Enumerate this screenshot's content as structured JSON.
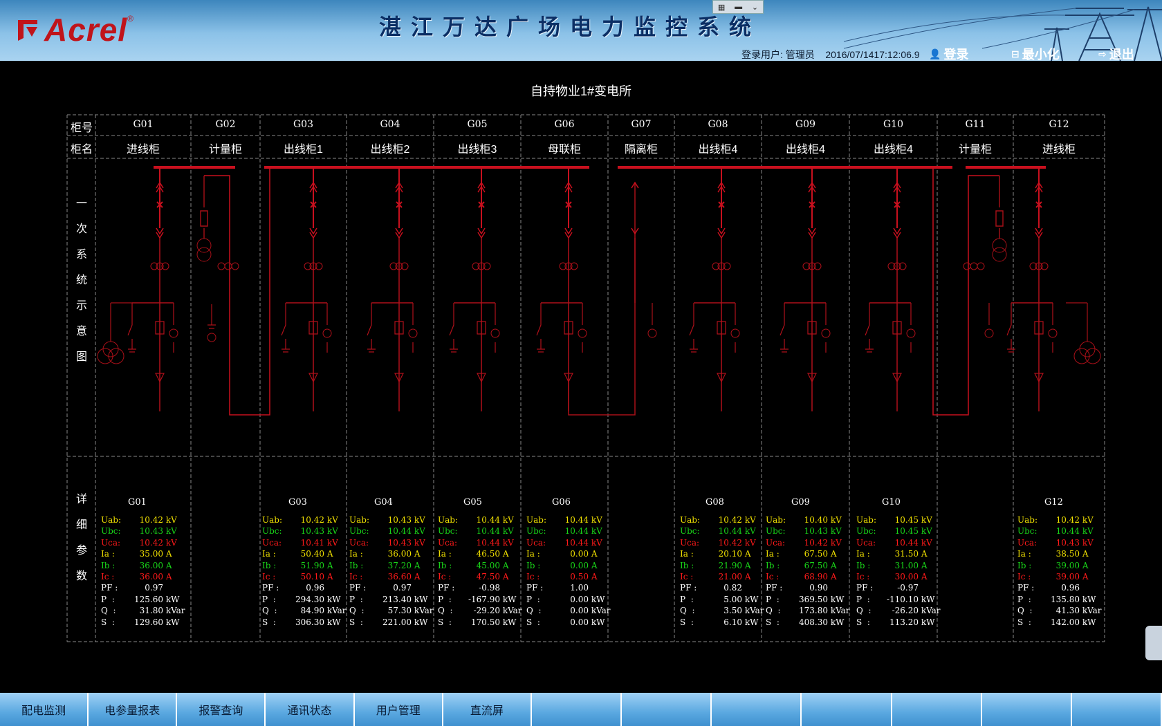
{
  "header": {
    "logo_text": "Acrel",
    "logo_mark": "®",
    "title": "湛江万达广场电力监控系统",
    "login_user_label": "登录用户: 管理员",
    "datetime": "2016/07/1417:12:06.9",
    "login_button": "登录",
    "minimize_button": "最小化",
    "exit_button": "退出"
  },
  "panel_title": "自持物业1#变电所",
  "grid": {
    "row_label_cabinet_no": "柜号",
    "row_label_cabinet_name": "柜名",
    "diagram_label": [
      "一",
      "次",
      "系",
      "统",
      "示",
      "意",
      "图"
    ],
    "params_label": [
      "详",
      "细",
      "参",
      "数"
    ]
  },
  "cabinets": [
    {
      "no": "G01",
      "name": "进线柜"
    },
    {
      "no": "G02",
      "name": "计量柜"
    },
    {
      "no": "G03",
      "name": "出线柜1"
    },
    {
      "no": "G04",
      "name": "出线柜2"
    },
    {
      "no": "G05",
      "name": "出线柜3"
    },
    {
      "no": "G06",
      "name": "母联柜"
    },
    {
      "no": "G07",
      "name": "隔离柜"
    },
    {
      "no": "G08",
      "name": "出线柜4"
    },
    {
      "no": "G09",
      "name": "出线柜4"
    },
    {
      "no": "G10",
      "name": "出线柜4"
    },
    {
      "no": "G11",
      "name": "计量柜"
    },
    {
      "no": "G12",
      "name": "进线柜"
    }
  ],
  "params": [
    {
      "id": "G01",
      "Uab": "10.42",
      "Ubc": "10.43",
      "Uca": "10.42",
      "Ia": "35.00",
      "Ib": "36.00",
      "Ic": "36.00",
      "PF": "0.97",
      "P": "125.60",
      "Q": "31.80",
      "S": "129.60"
    },
    {
      "id": "G03",
      "Uab": "10.42",
      "Ubc": "10.43",
      "Uca": "10.41",
      "Ia": "50.40",
      "Ib": "51.90",
      "Ic": "50.10",
      "PF": "0.96",
      "P": "294.30",
      "Q": "84.90",
      "S": "306.30"
    },
    {
      "id": "G04",
      "Uab": "10.43",
      "Ubc": "10.44",
      "Uca": "10.43",
      "Ia": "36.00",
      "Ib": "37.20",
      "Ic": "36.60",
      "PF": "0.97",
      "P": "213.40",
      "Q": "57.30",
      "S": "221.00"
    },
    {
      "id": "G05",
      "Uab": "10.44",
      "Ubc": "10.44",
      "Uca": "10.44",
      "Ia": "46.50",
      "Ib": "45.00",
      "Ic": "47.50",
      "PF": "-0.98",
      "P": "-167.90",
      "Q": "-29.20",
      "S": "170.50"
    },
    {
      "id": "G06",
      "Uab": "10.44",
      "Ubc": "10.44",
      "Uca": "10.44",
      "Ia": "0.00",
      "Ib": "0.00",
      "Ic": "0.50",
      "PF": "1.00",
      "P": "0.00",
      "Q": "0.00",
      "S": "0.00"
    },
    {
      "id": "G08",
      "Uab": "10.42",
      "Ubc": "10.44",
      "Uca": "10.42",
      "Ia": "20.10",
      "Ib": "21.90",
      "Ic": "21.00",
      "PF": "0.82",
      "P": "5.00",
      "Q": "3.50",
      "S": "6.10"
    },
    {
      "id": "G09",
      "Uab": "10.40",
      "Ubc": "10.43",
      "Uca": "10.42",
      "Ia": "67.50",
      "Ib": "67.50",
      "Ic": "68.90",
      "PF": "0.90",
      "P": "369.50",
      "Q": "173.80",
      "S": "408.30"
    },
    {
      "id": "G10",
      "Uab": "10.45",
      "Ubc": "10.45",
      "Uca": "10.44",
      "Ia": "31.50",
      "Ib": "31.00",
      "Ic": "30.00",
      "PF": "-0.97",
      "P": "-110.10",
      "Q": "-26.20",
      "S": "113.20"
    },
    {
      "id": "G12",
      "Uab": "10.42",
      "Ubc": "10.44",
      "Uca": "10.43",
      "Ia": "38.50",
      "Ib": "39.00",
      "Ic": "39.00",
      "PF": "0.96",
      "P": "135.80",
      "Q": "41.30",
      "S": "142.00"
    }
  ],
  "param_labels": {
    "Uab": "Uab:",
    "Ubc": "Ubc:",
    "Uca": "Uca:",
    "Ia": "Ia :",
    "Ib": "Ib :",
    "Ic": "Ic :",
    "PF": "PF :",
    "P": "P  :",
    "Q": "Q  :",
    "S": "S  :"
  },
  "units": {
    "voltage": "kV",
    "current": "A",
    "p": "kW",
    "q": "kVar",
    "s": "kW"
  },
  "footer_tabs": [
    "配电监测",
    "电参量报表",
    "报警查询",
    "通讯状态",
    "用户管理",
    "直流屏"
  ],
  "colors": {
    "voltage_ab": "#f0e000",
    "voltage_bc": "#19d519",
    "voltage_ca": "#ff1a1a",
    "busbar": "#c8101e",
    "diagram": "#b0101a"
  }
}
